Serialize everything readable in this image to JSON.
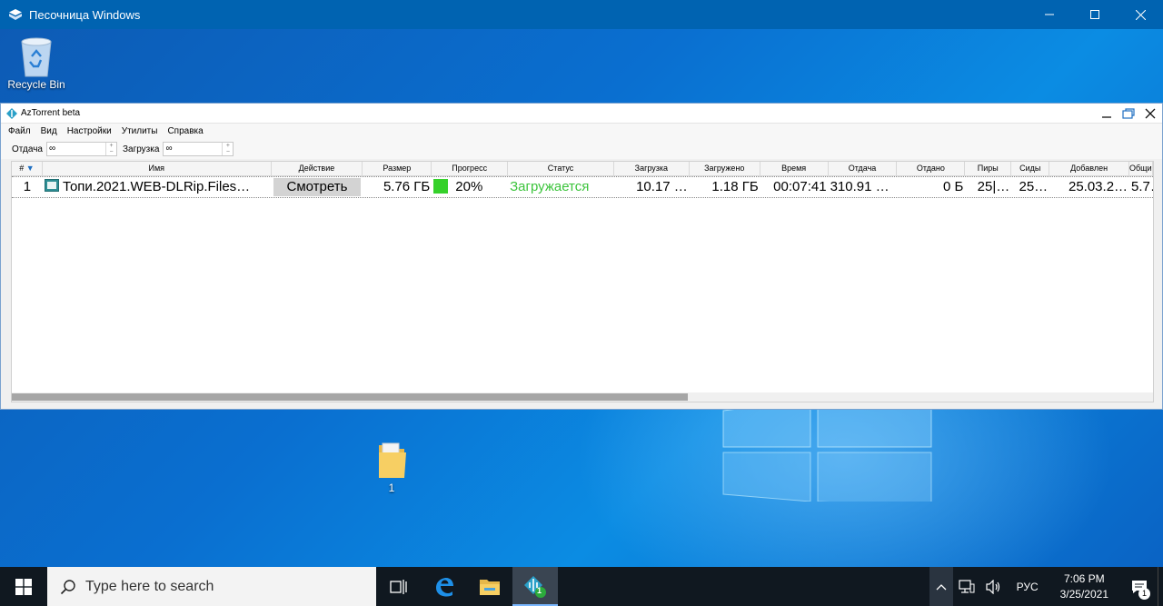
{
  "sandbox": {
    "title": "Песочница Windows"
  },
  "desktop": {
    "icons": [
      {
        "label": "Recycle Bin"
      },
      {
        "label": "1"
      }
    ]
  },
  "az": {
    "title": "AzTorrent beta",
    "menu": [
      "Файл",
      "Вид",
      "Настройки",
      "Утилиты",
      "Справка"
    ],
    "speed": {
      "upload_label": "Отдача",
      "upload_value": "∞",
      "download_label": "Загрузка",
      "download_value": "∞",
      "spin_up": "+",
      "spin_down": "−"
    },
    "columns": [
      "#",
      "Имя",
      "Действие",
      "Размер",
      "Прогресс",
      "Статус",
      "Загрузка",
      "Загружено",
      "Время",
      "Отдача",
      "Отдано",
      "Пиры",
      "Сиды",
      "Добавлен",
      "Общий"
    ],
    "sort_indicator": "▼",
    "row": {
      "index": "1",
      "name": "Топи.2021.WEB-DLRip.Files…",
      "action": "Смотреть",
      "size": "5.76 ГБ",
      "progress": "20%",
      "progress_value": 0.2,
      "status": "Загружается",
      "download_speed": "10.17 …",
      "downloaded": "1.18 ГБ",
      "time": "00:07:41",
      "upload_speed": "310.91 …",
      "uploaded": "0 Б",
      "peers": "25|…",
      "seeds": "25…",
      "added": "25.03.2…",
      "total": "5.7…"
    },
    "colors": {
      "progress": "#35d12a",
      "status": "#3cc43c"
    }
  },
  "taskbar": {
    "search_placeholder": "Type here to search",
    "language": "РУС",
    "time": "7:06 PM",
    "date": "3/25/2021",
    "torrent_badge": "1",
    "notification_count": "1"
  }
}
